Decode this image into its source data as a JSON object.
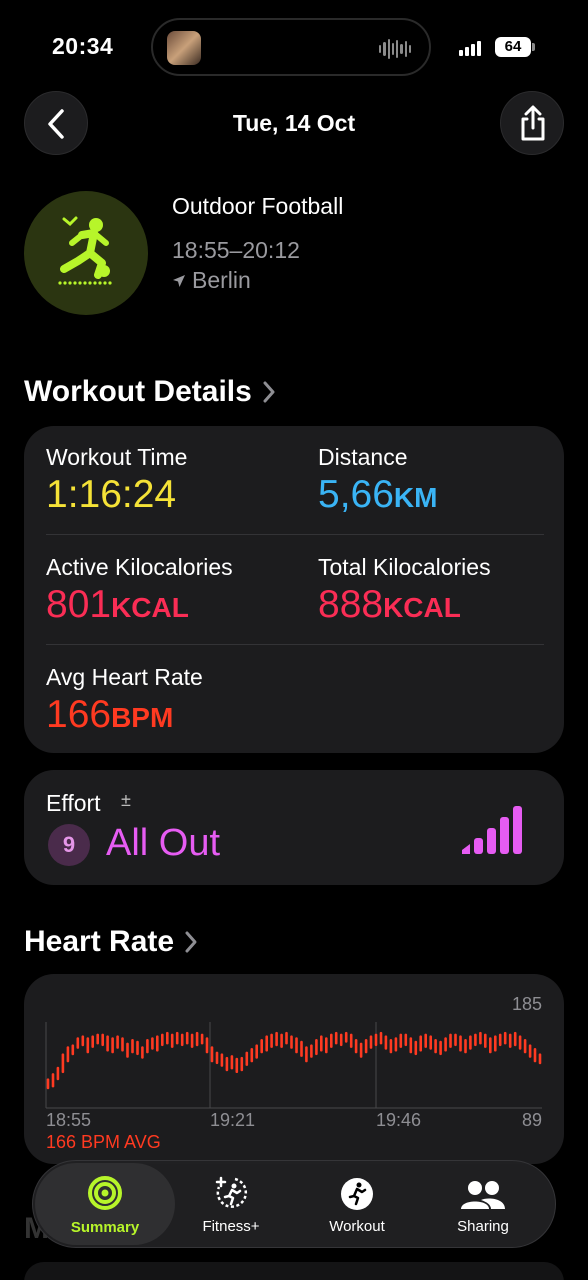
{
  "status_bar": {
    "time": "20:34",
    "battery": "64"
  },
  "nav": {
    "title": "Tue, 14 Oct",
    "back_icon": "chevron-left-icon",
    "share_icon": "share-icon"
  },
  "workout": {
    "name": "Outdoor Football",
    "time_range": "18:55–20:12",
    "location": "Berlin",
    "icon": "soccer-player-icon",
    "accent": "#b7f52a"
  },
  "details": {
    "title": "Workout Details",
    "workout_time": {
      "label": "Workout Time",
      "value": "1:16:24",
      "color": "#f5e237"
    },
    "distance": {
      "label": "Distance",
      "value": "5,66",
      "unit": "KM",
      "color": "#3ab4f5"
    },
    "active_kcal": {
      "label": "Active Kilocalories",
      "value": "801",
      "unit": "KCAL",
      "color": "#fa2d55"
    },
    "total_kcal": {
      "label": "Total Kilocalories",
      "value": "888",
      "unit": "KCAL",
      "color": "#fa2d55"
    },
    "avg_hr": {
      "label": "Avg Heart Rate",
      "value": "166",
      "unit": "BPM",
      "color": "#ff3a21"
    }
  },
  "effort": {
    "label": "Effort",
    "plus_minus": "±",
    "score": "9",
    "text": "All Out",
    "level": 5,
    "max_level": 5,
    "color": "#e65cf2"
  },
  "heart_rate": {
    "title": "Heart Rate",
    "avg_label": "166 BPM AVG",
    "max_label": "185",
    "min_label": "89",
    "time_labels": [
      "18:55",
      "19:21",
      "19:46"
    ]
  },
  "chart_data": {
    "type": "bar",
    "title": "",
    "ylim": [
      89,
      185
    ],
    "series": [
      {
        "color": "#ff3a21",
        "values": [
          [
            110,
            122
          ],
          [
            112,
            128
          ],
          [
            120,
            135
          ],
          [
            128,
            150
          ],
          [
            140,
            158
          ],
          [
            148,
            160
          ],
          [
            155,
            168
          ],
          [
            158,
            170
          ],
          [
            150,
            168
          ],
          [
            156,
            170
          ],
          [
            160,
            172
          ],
          [
            158,
            172
          ],
          [
            152,
            170
          ],
          [
            150,
            168
          ],
          [
            155,
            170
          ],
          [
            152,
            168
          ],
          [
            145,
            162
          ],
          [
            150,
            166
          ],
          [
            148,
            164
          ],
          [
            144,
            158
          ],
          [
            150,
            166
          ],
          [
            154,
            168
          ],
          [
            152,
            170
          ],
          [
            158,
            172
          ],
          [
            160,
            174
          ],
          [
            156,
            172
          ],
          [
            160,
            174
          ],
          [
            158,
            172
          ],
          [
            160,
            174
          ],
          [
            156,
            172
          ],
          [
            158,
            174
          ],
          [
            160,
            172
          ],
          [
            150,
            168
          ],
          [
            140,
            158
          ],
          [
            138,
            152
          ],
          [
            135,
            150
          ],
          [
            130,
            146
          ],
          [
            132,
            148
          ],
          [
            128,
            145
          ],
          [
            130,
            146
          ],
          [
            136,
            152
          ],
          [
            140,
            156
          ],
          [
            144,
            160
          ],
          [
            150,
            166
          ],
          [
            152,
            170
          ],
          [
            156,
            172
          ],
          [
            158,
            174
          ],
          [
            156,
            172
          ],
          [
            160,
            174
          ],
          [
            155,
            170
          ],
          [
            150,
            168
          ],
          [
            146,
            164
          ],
          [
            140,
            158
          ],
          [
            145,
            160
          ],
          [
            148,
            166
          ],
          [
            152,
            170
          ],
          [
            150,
            168
          ],
          [
            156,
            172
          ],
          [
            160,
            174
          ],
          [
            158,
            172
          ],
          [
            162,
            174
          ],
          [
            156,
            172
          ],
          [
            150,
            166
          ],
          [
            145,
            162
          ],
          [
            150,
            166
          ],
          [
            155,
            170
          ],
          [
            158,
            172
          ],
          [
            160,
            174
          ],
          [
            154,
            170
          ],
          [
            150,
            166
          ],
          [
            152,
            168
          ],
          [
            156,
            172
          ],
          [
            158,
            172
          ],
          [
            150,
            168
          ],
          [
            148,
            164
          ],
          [
            152,
            170
          ],
          [
            156,
            172
          ],
          [
            154,
            170
          ],
          [
            150,
            166
          ],
          [
            148,
            164
          ],
          [
            152,
            168
          ],
          [
            156,
            172
          ],
          [
            158,
            172
          ],
          [
            152,
            170
          ],
          [
            150,
            166
          ],
          [
            154,
            170
          ],
          [
            158,
            172
          ],
          [
            160,
            174
          ],
          [
            156,
            172
          ],
          [
            150,
            168
          ],
          [
            152,
            170
          ],
          [
            158,
            172
          ],
          [
            160,
            174
          ],
          [
            156,
            172
          ],
          [
            158,
            174
          ],
          [
            154,
            170
          ],
          [
            150,
            166
          ],
          [
            145,
            160
          ],
          [
            140,
            156
          ],
          [
            138,
            150
          ]
        ]
      }
    ]
  },
  "tabs": [
    {
      "label": "Summary",
      "icon": "activity-rings-icon",
      "active": true
    },
    {
      "label": "Fitness+",
      "icon": "fitness-plus-icon",
      "active": false
    },
    {
      "label": "Workout",
      "icon": "running-figure-icon",
      "active": false
    },
    {
      "label": "Sharing",
      "icon": "people-icon",
      "active": false
    }
  ]
}
